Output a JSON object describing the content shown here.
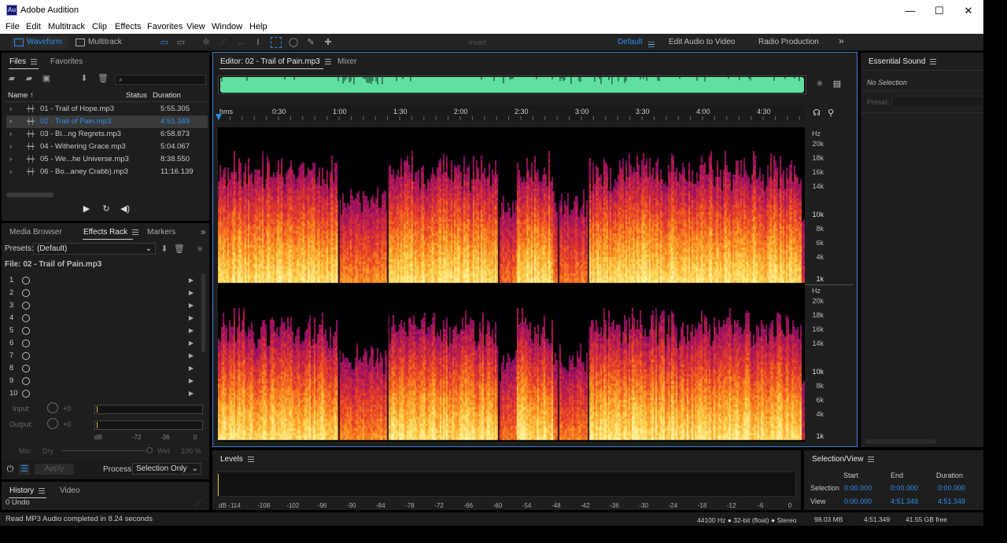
{
  "window": {
    "title": "Adobe Audition",
    "app_icon": "Au",
    "minimize": "—",
    "maximize": "☐",
    "close": "✕"
  },
  "menu": [
    "File",
    "Edit",
    "Multitrack",
    "Clip",
    "Effects",
    "Favorites",
    "View",
    "Window",
    "Help"
  ],
  "toolbar": {
    "waveform_label": "Waveform",
    "multitrack_label": "Multitrack",
    "invert_label": "Invert",
    "workspaces": [
      "Default",
      "Edit Audio to Video",
      "Radio Production"
    ],
    "more_icon": "»"
  },
  "files_panel": {
    "tab_files": "Files",
    "tab_favorites": "Favorites",
    "col_name": "Name",
    "col_status": "Status",
    "col_duration": "Duration",
    "search_placeholder": "",
    "files": [
      {
        "name": "01 - Trail of Hope.mp3",
        "duration": "5:55.305"
      },
      {
        "name": "02 - Trail of Pain.mp3",
        "duration": "4:51.349"
      },
      {
        "name": "03 - Bl...ng Regrets.mp3",
        "duration": "6:58.873"
      },
      {
        "name": "04 - Withering Grace.mp3",
        "duration": "5:04.067"
      },
      {
        "name": "05 - We...he Universe.mp3",
        "duration": "8:38.550"
      },
      {
        "name": "06 - Bo...aney Crabb).mp3",
        "duration": "11:16.139"
      }
    ]
  },
  "effects_panel": {
    "tab_media_browser": "Media Browser",
    "tab_effects_rack": "Effects Rack",
    "tab_markers": "Markers",
    "presets_label": "Presets:",
    "presets_value": "(Default)",
    "file_label": "File: 02 - Trail of Pain.mp3",
    "slots": [
      "1",
      "2",
      "3",
      "4",
      "5",
      "6",
      "7",
      "8",
      "9",
      "10"
    ],
    "input_label": "Input:",
    "input_gain": "+0",
    "output_label": "Output:",
    "output_gain": "+0",
    "meter_scale": [
      "dB",
      "-72",
      "-36",
      "0"
    ],
    "mix_label": "Mix:",
    "dry_label": "Dry",
    "wet_label": "Wet",
    "mix_value": "100 %",
    "apply_label": "Apply",
    "process_label": "Process:",
    "process_value": "Selection Only"
  },
  "history_panel": {
    "tab_history": "History",
    "tab_video": "Video",
    "undo_count": "0 Undo"
  },
  "editor": {
    "tab_editor": "Editor: 02 - Trail of Pain.mp3",
    "tab_mixer": "Mixer",
    "ruler_unit": "hms",
    "ruler_labels": [
      "0:30",
      "1:00",
      "1:30",
      "2:00",
      "2:30",
      "3:00",
      "3:30",
      "4:00",
      "4:30"
    ],
    "hz_unit": "Hz",
    "hz_labels": [
      "20k",
      "18k",
      "16k",
      "14k",
      "10k",
      "8k",
      "6k",
      "4k",
      "1k"
    ]
  },
  "essential_sound": {
    "title": "Essential Sound",
    "no_selection": "No Selection",
    "preset_label": "Preset:"
  },
  "levels_panel": {
    "title": "Levels",
    "scale": [
      "dB",
      "-114",
      "-108",
      "-102",
      "-96",
      "-90",
      "-84",
      "-78",
      "-72",
      "-66",
      "-60",
      "-54",
      "-48",
      "-42",
      "-36",
      "-30",
      "-24",
      "-18",
      "-12",
      "-6",
      "0"
    ]
  },
  "selection_view": {
    "title": "Selection/View",
    "col_start": "Start",
    "col_end": "End",
    "col_duration": "Duration",
    "row_selection": "Selection",
    "row_view": "View",
    "selection_start": "0:00.000",
    "selection_end": "0:00.000",
    "selection_duration": "0:00.000",
    "view_start": "0:00.000",
    "view_end": "4:51.349",
    "view_duration": "4:51.349"
  },
  "status_bar": {
    "message": "Read MP3 Audio completed in 8.24 seconds",
    "format": "44100 Hz ● 32-bit (float) ● Stereo",
    "size": "98.03 MB",
    "duration": "4:51.349",
    "free": "41.55 GB free"
  },
  "colors": {
    "accent": "#2d8ceb",
    "waveform_overview": "#5fe0a0",
    "panel_bg": "#1e1e1e",
    "editor_border": "#3c7fd6"
  }
}
